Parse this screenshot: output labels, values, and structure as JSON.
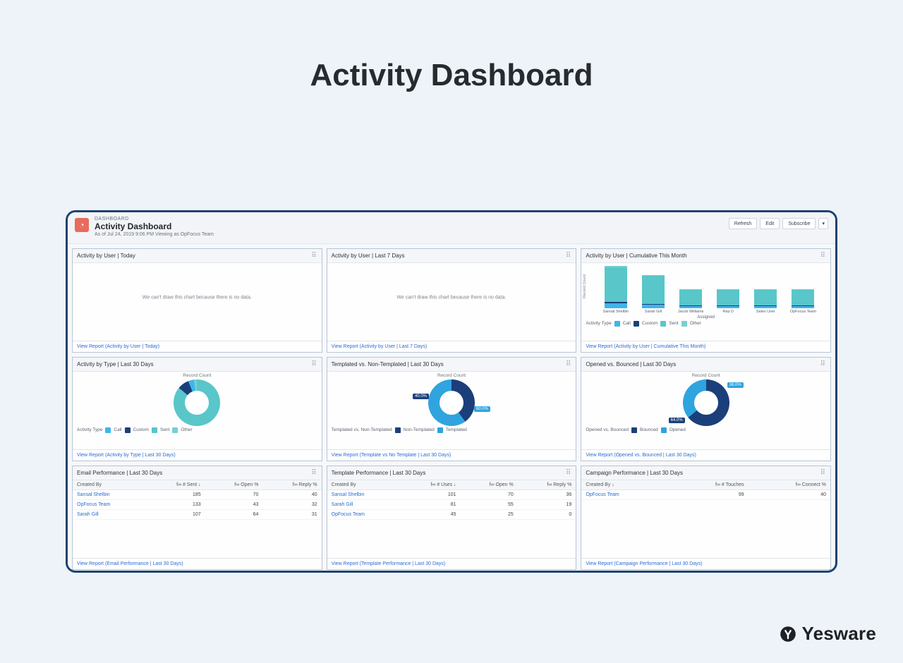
{
  "page_title": "Activity Dashboard",
  "brand": "Yesware",
  "header": {
    "eyebrow": "DASHBOARD",
    "title": "Activity Dashboard",
    "subtitle": "As of Jul 24, 2019 9:06 PM Viewing as OpFocus Team",
    "icon_name": "gauge-icon",
    "actions": {
      "refresh": "Refresh",
      "edit": "Edit",
      "subscribe": "Subscribe"
    }
  },
  "empty_message": "We can't draw this chart because there is no data.",
  "cards": {
    "activity_user_today": {
      "title": "Activity by User | Today",
      "footer": "View Report (Activity by User | Today)"
    },
    "activity_user_7": {
      "title": "Activity by User | Last 7 Days",
      "footer": "View Report (Activity by User | Last 7 Days)"
    },
    "activity_user_month": {
      "title": "Activity by User | Cumulative This Month",
      "footer": "View Report (Activity by User | Cumulative This Month)",
      "y_label": "Record Count",
      "x_label": "Assigned",
      "legend_label": "Activity Type",
      "legend": [
        "Call",
        "Custom",
        "Sent",
        "Other"
      ]
    },
    "activity_type_30": {
      "title": "Activity by Type | Last 30 Days",
      "footer": "View Report (Activity by Type | Last 30 Days)",
      "legend_label": "Activity Type",
      "legend": [
        "Call",
        "Custom",
        "Sent",
        "Other"
      ],
      "center_title": "Record Count"
    },
    "templated_vs": {
      "title": "Templated vs. Non-Templated | Last 30 Days",
      "footer": "View Report (Template vs No Template | Last 30 Days)",
      "legend_label": "Templated vs. Non-Templated",
      "legend": [
        "Non-Templated",
        "Templated"
      ],
      "center_title": "Record Count"
    },
    "opened_bounced": {
      "title": "Opened vs. Bounced | Last 30 Days",
      "footer": "View Report (Opened vs. Bounced | Last 30 Days)",
      "legend_label": "Opened vs. Bounced",
      "legend": [
        "Bounced",
        "Opened"
      ],
      "center_title": "Record Count"
    },
    "email_perf": {
      "title": "Email Performance | Last 30 Days",
      "footer": "View Report (Email Performance | Last 30 Days)",
      "columns": [
        "Created By",
        "f∞ # Sent ↓",
        "f∞ Open %",
        "f∞ Reply %"
      ]
    },
    "template_perf": {
      "title": "Template Performance | Last 30 Days",
      "footer": "View Report (Template Performance | Last 30 Days)",
      "columns": [
        "Created By",
        "f∞ # Uses ↓",
        "f∞ Open %",
        "f∞ Reply %"
      ]
    },
    "campaign_perf": {
      "title": "Campaign Performance | Last 30 Days",
      "footer": "View Report (Campaign Performance | Last 30 Days)",
      "columns": [
        "Created By ↓",
        "f∞ # Touches",
        "f∞ Connect %"
      ]
    }
  },
  "chart_data": [
    {
      "type": "bar",
      "id": "activity_user_month",
      "categories": [
        "Sansal Shelbin",
        "Sarah Gill",
        "Jacob Williams",
        "Rep D",
        "Sales User",
        "OpFocus Team"
      ],
      "series": [
        {
          "name": "Call",
          "color": "#3fb4ed",
          "values": [
            8,
            6,
            3,
            3,
            3,
            3
          ]
        },
        {
          "name": "Custom",
          "color": "#1b3f7a",
          "values": [
            2,
            1,
            1,
            1,
            1,
            1
          ]
        },
        {
          "name": "Sent",
          "color": "#59c6c9",
          "values": [
            58,
            46,
            26,
            26,
            26,
            26
          ]
        },
        {
          "name": "Other",
          "color": "#76d0d2",
          "values": [
            2,
            2,
            1,
            1,
            1,
            1
          ]
        }
      ],
      "ylabel": "Record Count",
      "xlabel": "Assigned",
      "ylim": [
        0,
        70
      ]
    },
    {
      "type": "pie",
      "id": "activity_type_30",
      "slices": [
        {
          "name": "Sent",
          "value": 86,
          "color": "#59c6c9"
        },
        {
          "name": "Custom",
          "value": 8,
          "color": "#1b3f7a"
        },
        {
          "name": "Call",
          "value": 4,
          "color": "#3fb4ed"
        },
        {
          "name": "Other",
          "value": 2,
          "color": "#76d0d2"
        }
      ],
      "title": "Record Count"
    },
    {
      "type": "pie",
      "id": "templated_vs",
      "slices": [
        {
          "name": "Non-Templated",
          "value": 40,
          "color": "#1b3f7a",
          "label": "40.0%"
        },
        {
          "name": "Templated",
          "value": 60,
          "color": "#2fa4df",
          "label": "60.0%"
        }
      ],
      "title": "Record Count"
    },
    {
      "type": "pie",
      "id": "opened_bounced",
      "slices": [
        {
          "name": "Bounced",
          "value": 64,
          "color": "#1b3f7a",
          "label": "64.0%"
        },
        {
          "name": "Opened",
          "value": 36,
          "color": "#2fa4df",
          "label": "36.0%"
        }
      ],
      "title": "Record Count"
    },
    {
      "type": "table",
      "id": "email_perf",
      "columns": [
        "Created By",
        "# Sent",
        "Open %",
        "Reply %"
      ],
      "rows": [
        [
          "Sansal Shelbin",
          185,
          70,
          40
        ],
        [
          "OpFocus Team",
          133,
          43,
          32
        ],
        [
          "Sarah Gill",
          107,
          64,
          31
        ]
      ]
    },
    {
      "type": "table",
      "id": "template_perf",
      "columns": [
        "Created By",
        "# Uses",
        "Open %",
        "Reply %"
      ],
      "rows": [
        [
          "Sansal Shelbin",
          101,
          70,
          36
        ],
        [
          "Sarah Gill",
          81,
          55,
          19
        ],
        [
          "OpFocus Team",
          45,
          25,
          0
        ]
      ]
    },
    {
      "type": "table",
      "id": "campaign_perf",
      "columns": [
        "Created By",
        "# Touches",
        "Connect %"
      ],
      "rows": [
        [
          "OpFocus Team",
          99,
          40
        ]
      ]
    }
  ]
}
